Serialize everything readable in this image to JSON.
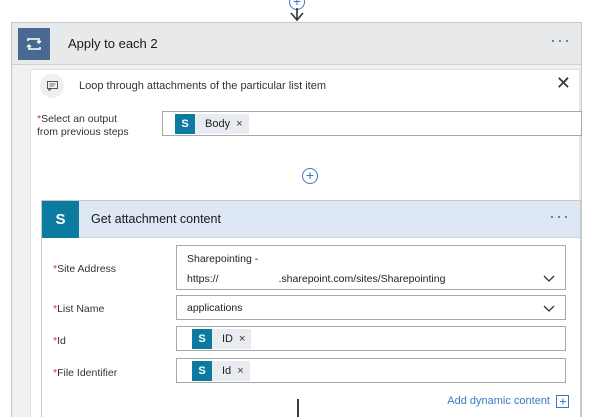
{
  "top_add_symbol": "+",
  "loop_step": {
    "title": "Apply to each 2",
    "more_label": "···",
    "comment": "Loop through attachments of the particular list item",
    "close_symbol": "✕",
    "select_label_line1": "Select an output",
    "select_label_line2": "from previous steps",
    "required_mark": "*",
    "select_token": {
      "label": "Body",
      "remove": "×"
    },
    "add_symbol": "+"
  },
  "action": {
    "title": "Get attachment content",
    "more_label": "···",
    "fields": {
      "site_address": {
        "label": "Site Address",
        "value_line1": "Sharepointing -",
        "value_line2_prefix": "https://",
        "value_line2_suffix": ".sharepoint.com/sites/Sharepointing"
      },
      "list_name": {
        "label": "List Name",
        "value": "applications"
      },
      "id": {
        "label": "Id",
        "token": "ID",
        "remove": "×"
      },
      "file_identifier": {
        "label": "File Identifier",
        "token": "Id",
        "remove": "×"
      }
    },
    "dynamic_content": "Add dynamic content"
  },
  "colors": {
    "accent": "#3a7ac4",
    "loop_icon_bg": "#486991",
    "sharepoint": "#0b7ba0",
    "required": "#c0392b"
  },
  "icons": {
    "loop": "loop-icon",
    "comment": "comment-icon",
    "sharepoint": "sharepoint-icon",
    "chevron": "chevron-down-icon",
    "close": "close-icon"
  }
}
